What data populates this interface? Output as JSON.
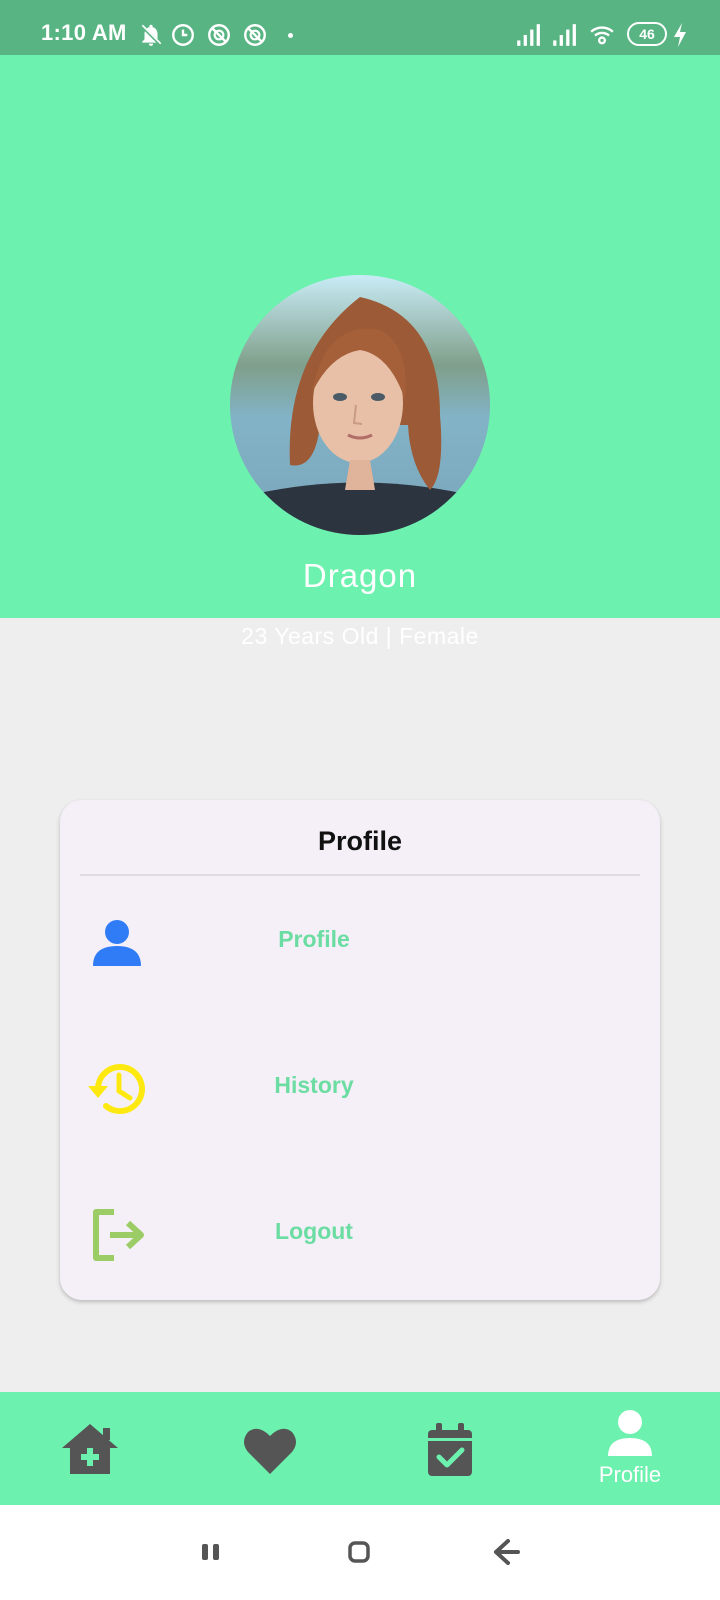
{
  "status_bar": {
    "time": "1:10 AM",
    "battery": "46",
    "icons": [
      "bell-off-icon",
      "clock-icon",
      "no-entry-icon",
      "no-entry-icon",
      "signal-icon",
      "signal-icon",
      "wifi-icon",
      "battery-icon",
      "charging-icon"
    ]
  },
  "profile": {
    "name": "Dragon",
    "meta": "23 Years Old | Female"
  },
  "card": {
    "title": "Profile",
    "items": [
      {
        "label": "Profile",
        "icon": "person-icon",
        "color": "#2f7cf6"
      },
      {
        "label": "History",
        "icon": "history-icon",
        "color": "#fde910"
      },
      {
        "label": "Logout",
        "icon": "logout-icon",
        "color": "#9ccc65"
      }
    ]
  },
  "bottom_nav": {
    "items": [
      {
        "icon": "home-plus-icon"
      },
      {
        "icon": "heart-icon"
      },
      {
        "icon": "calendar-check-icon"
      },
      {
        "icon": "person-icon",
        "label": "Profile",
        "active": true
      }
    ]
  },
  "colors": {
    "primary": "#6cf1ae",
    "status_bar": "#58b583",
    "label": "#6cdda2",
    "nav_icon": "#555555"
  }
}
